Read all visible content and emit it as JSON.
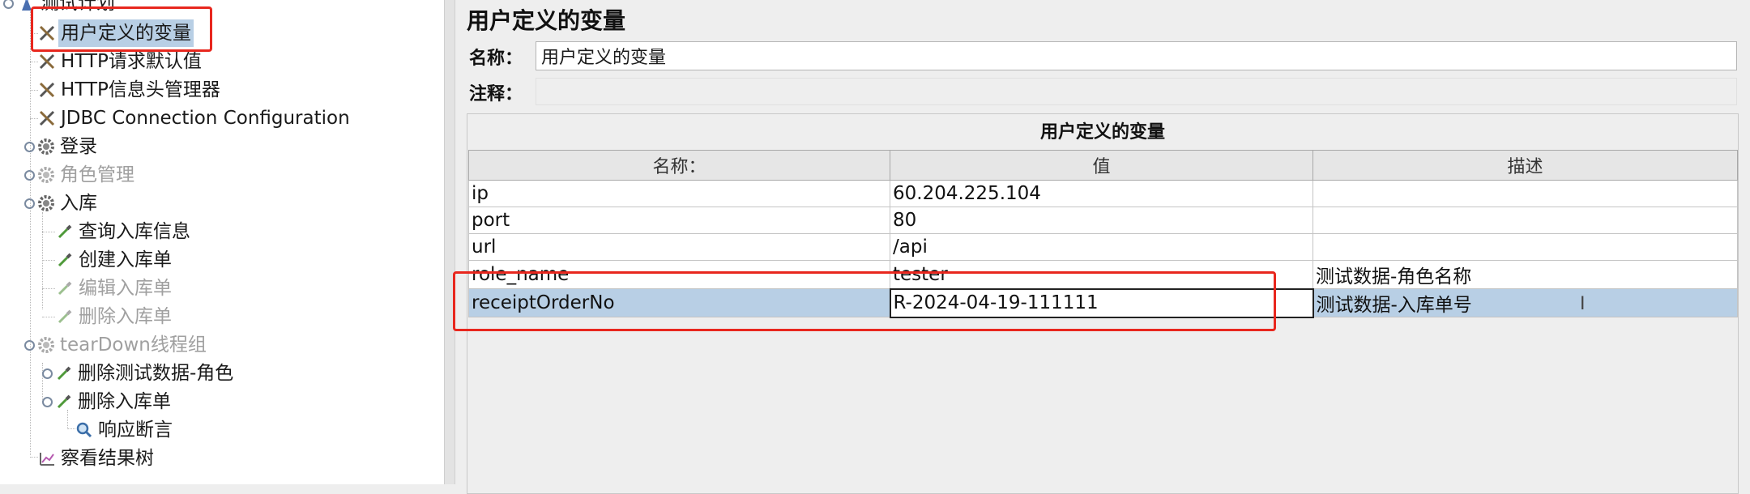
{
  "tree": {
    "items": [
      {
        "label": "测试计划",
        "icon": "test-plan-icon",
        "state": "normal"
      },
      {
        "label": "用户定义的变量",
        "icon": "config-wrench-icon",
        "state": "selected"
      },
      {
        "label": "HTTP请求默认值",
        "icon": "config-wrench-icon",
        "state": "normal"
      },
      {
        "label": "HTTP信息头管理器",
        "icon": "config-wrench-icon",
        "state": "normal"
      },
      {
        "label": "JDBC Connection Configuration",
        "icon": "config-wrench-icon",
        "state": "normal"
      },
      {
        "label": "登录",
        "icon": "thread-group-gear-icon",
        "state": "normal"
      },
      {
        "label": "角色管理",
        "icon": "thread-group-gear-icon",
        "state": "disabled"
      },
      {
        "label": "入库",
        "icon": "thread-group-gear-icon",
        "state": "normal"
      },
      {
        "label": "查询入库信息",
        "icon": "sampler-pipette-icon",
        "state": "normal"
      },
      {
        "label": "创建入库单",
        "icon": "sampler-pipette-icon",
        "state": "normal"
      },
      {
        "label": "编辑入库单",
        "icon": "sampler-pipette-icon",
        "state": "disabled"
      },
      {
        "label": "删除入库单",
        "icon": "sampler-pipette-icon",
        "state": "disabled"
      },
      {
        "label": "tearDown线程组",
        "icon": "thread-group-gear-icon",
        "state": "disabled"
      },
      {
        "label": "删除测试数据-角色",
        "icon": "sampler-pipette-icon",
        "state": "normal"
      },
      {
        "label": "删除入库单",
        "icon": "sampler-pipette-icon",
        "state": "normal"
      },
      {
        "label": "响应断言",
        "icon": "assertion-magnifier-icon",
        "state": "normal"
      },
      {
        "label": "察看结果树",
        "icon": "listener-chart-icon",
        "state": "normal"
      }
    ]
  },
  "editor": {
    "title": "用户定义的变量",
    "name_label": "名称：",
    "name_value": "用户定义的变量",
    "comment_label": "注释：",
    "comment_value": "",
    "group_title": "用户定义的变量",
    "table": {
      "headers": [
        "名称：",
        "值",
        "描述"
      ],
      "rows": [
        {
          "name": "ip",
          "value": "60.204.225.104",
          "desc": ""
        },
        {
          "name": "port",
          "value": "80",
          "desc": ""
        },
        {
          "name": "url",
          "value": "/api",
          "desc": ""
        },
        {
          "name": "role_name",
          "value": "tester",
          "desc": "测试数据-角色名称"
        },
        {
          "name": "receiptOrderNo",
          "value": "R-2024-04-19-111111",
          "desc": "测试数据-入库单号"
        }
      ]
    }
  },
  "colors": {
    "selection": "#b8cfe5",
    "annotation_red": "#e8271e",
    "disabled_text": "#a0a0a0"
  }
}
